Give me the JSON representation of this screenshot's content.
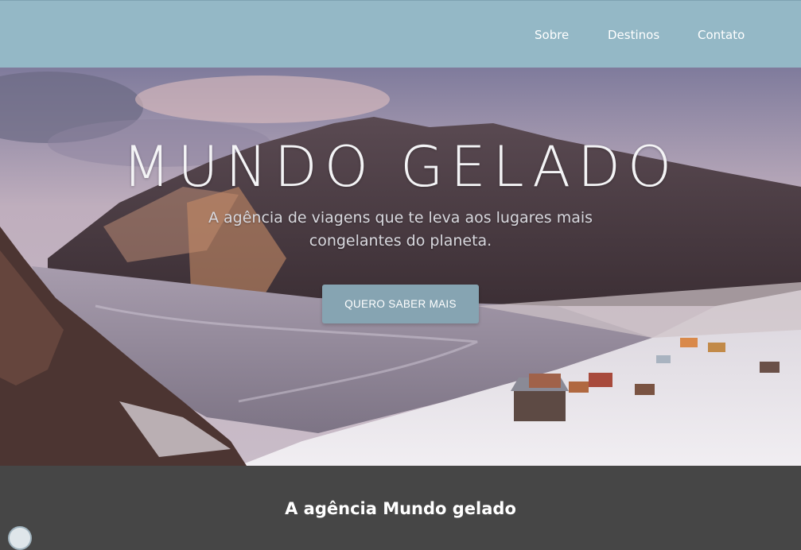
{
  "nav": {
    "items": [
      {
        "label": "Sobre"
      },
      {
        "label": "Destinos"
      },
      {
        "label": "Contato"
      }
    ]
  },
  "hero": {
    "title": "MUNDO GELADO",
    "subtitle": "A agência de viagens que te leva aos lugares mais congelantes do planeta.",
    "button_label": "QUERO SABER MAIS"
  },
  "section": {
    "title": "A agência Mundo gelado"
  },
  "colors": {
    "navbar": "#94b8c6",
    "button": "#86a4b2",
    "section_bg": "#464646"
  }
}
